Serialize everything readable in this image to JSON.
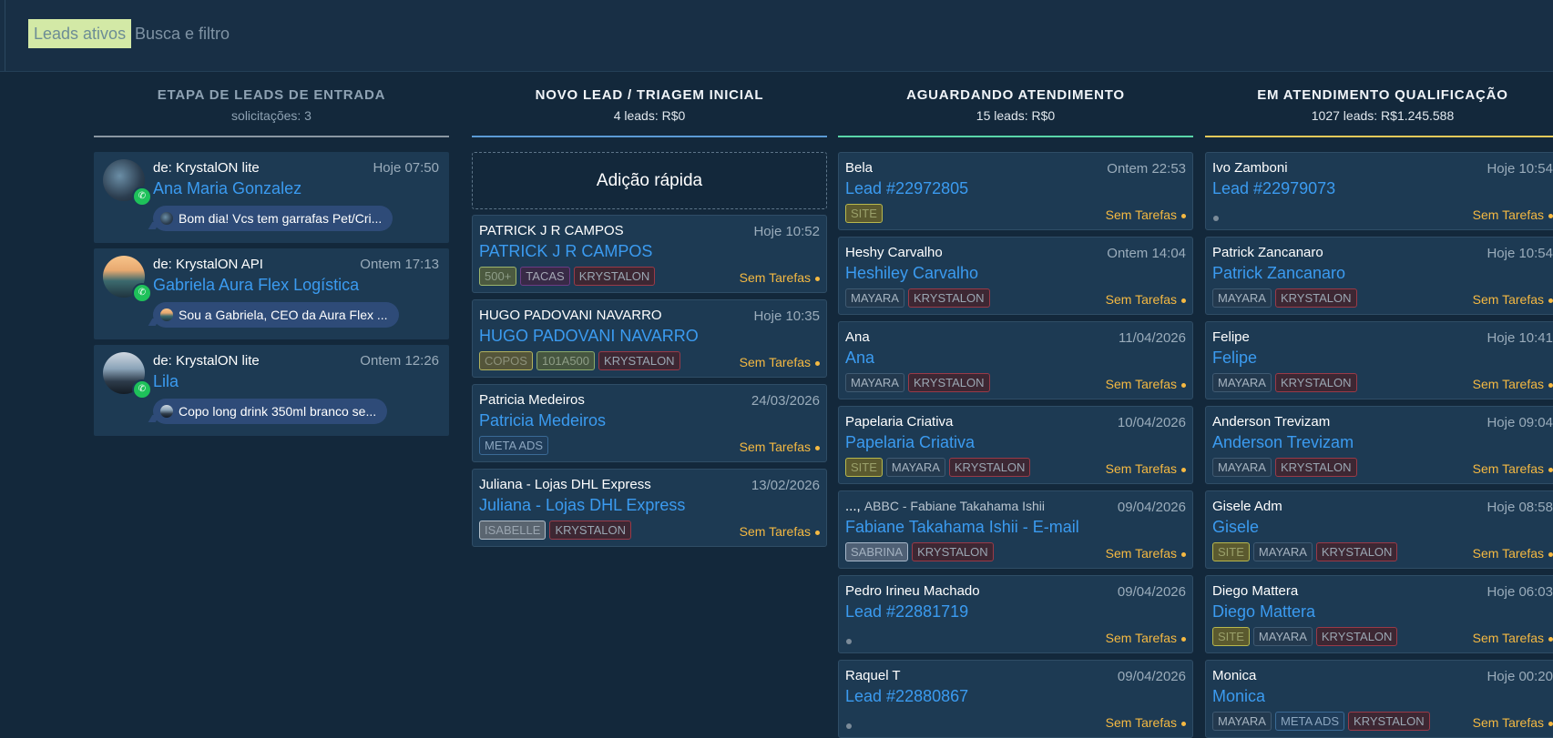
{
  "topbar": {
    "filter_pill": "Leads ativos",
    "search_placeholder": "Busca e filtro"
  },
  "columns": {
    "incoming": {
      "title": "ETAPA DE LEADS DE ENTRADA",
      "subtitle": "solicitações: 3",
      "line_color": "#8a97a2",
      "cards": [
        {
          "from": "de: KrystalON lite",
          "time": "Hoje 07:50",
          "name": "Ana Maria Gonzalez",
          "message": "Bom dia! Vcs tem garrafas Pet/Cri..."
        },
        {
          "from": "de: KrystalON API",
          "time": "Ontem 17:13",
          "name": "Gabriela Aura Flex Logística",
          "message": "Sou a Gabriela, CEO da Aura Flex ..."
        },
        {
          "from": "de: KrystalON lite",
          "time": "Ontem 12:26",
          "name": "Lila",
          "message": "Copo long drink 350ml branco se..."
        }
      ]
    },
    "novo": {
      "title": "NOVO LEAD / TRIAGEM INICIAL",
      "subtitle": "4 leads: R$0",
      "line_color": "#5b9bd5",
      "quick_add": "Adição rápida",
      "cards": [
        {
          "name": "PATRICK J R CAMPOS",
          "time": "Hoje 10:52",
          "lead": "PATRICK J R CAMPOS",
          "status": "Sem Tarefas",
          "tags": [
            {
              "label": "500+",
              "cls": "t-500"
            },
            {
              "label": "TACAS",
              "cls": "t-tacas"
            },
            {
              "label": "KRYSTALON",
              "cls": "t-krys"
            }
          ]
        },
        {
          "name": "HUGO PADOVANI NAVARRO",
          "time": "Hoje 10:35",
          "lead": "HUGO PADOVANI NAVARRO",
          "status": "Sem Tarefas",
          "tags": [
            {
              "label": "COPOS",
              "cls": "t-copos"
            },
            {
              "label": "101A500",
              "cls": "t-101"
            },
            {
              "label": "KRYSTALON",
              "cls": "t-krys"
            }
          ]
        },
        {
          "name": "Patricia Medeiros",
          "time": "24/03/2026",
          "lead": "Patricia Medeiros",
          "status": "Sem Tarefas",
          "tags": [
            {
              "label": "META ADS",
              "cls": "t-meta"
            }
          ]
        },
        {
          "name": "Juliana - Lojas DHL Express",
          "time": "13/02/2026",
          "lead": "Juliana - Lojas DHL Express",
          "status": "Sem Tarefas",
          "tags": [
            {
              "label": "ISABELLE",
              "cls": "t-isabelle"
            },
            {
              "label": "KRYSTALON",
              "cls": "t-krys"
            }
          ]
        }
      ]
    },
    "aguardando": {
      "title": "AGUARDANDO ATENDIMENTO",
      "subtitle": "15 leads: R$0",
      "line_color": "#5ad6a9",
      "cards": [
        {
          "name": "Bela",
          "time": "Ontem 22:53",
          "lead": "Lead #22972805",
          "status": "Sem Tarefas",
          "tags": [
            {
              "label": "SITE",
              "cls": "t-site"
            }
          ]
        },
        {
          "name": "Heshy Carvalho",
          "time": "Ontem 14:04",
          "lead": "Heshiley Carvalho",
          "status": "Sem Tarefas",
          "tags": [
            {
              "label": "MAYARA",
              "cls": "t-mayara"
            },
            {
              "label": "KRYSTALON",
              "cls": "t-krys"
            }
          ]
        },
        {
          "name": "Ana",
          "time": "11/04/2026",
          "lead": "Ana",
          "status": "Sem Tarefas",
          "tags": [
            {
              "label": "MAYARA",
              "cls": "t-mayara"
            },
            {
              "label": "KRYSTALON",
              "cls": "t-krys"
            }
          ]
        },
        {
          "name": "Papelaria Criativa",
          "time": "10/04/2026",
          "lead": "Papelaria Criativa",
          "status": "Sem Tarefas",
          "tags": [
            {
              "label": "SITE",
              "cls": "t-site"
            },
            {
              "label": "MAYARA",
              "cls": "t-mayara"
            },
            {
              "label": "KRYSTALON",
              "cls": "t-krys"
            }
          ]
        },
        {
          "prefix": "...,",
          "name": "ABBC - Fabiane Takahama Ishii",
          "time": "09/04/2026",
          "lead": "Fabiane Takahama Ishii - E-mail",
          "status": "Sem Tarefas",
          "tags": [
            {
              "label": "SABRINA",
              "cls": "t-sabrina"
            },
            {
              "label": "KRYSTALON",
              "cls": "t-krys"
            }
          ]
        },
        {
          "name": "Pedro Irineu Machado",
          "time": "09/04/2026",
          "lead": "Lead #22881719",
          "status": "Sem Tarefas",
          "tags": []
        },
        {
          "name": "Raquel T",
          "time": "09/04/2026",
          "lead": "Lead #22880867",
          "status": "Sem Tarefas",
          "tags": []
        }
      ]
    },
    "qualificacao": {
      "title": "EM ATENDIMENTO QUALIFICAÇÃO",
      "subtitle": "1027 leads: R$1.245.588",
      "line_color": "#e5c95a",
      "cards": [
        {
          "name": "Ivo Zamboni",
          "time": "Hoje 10:54",
          "lead": "Lead #22979073",
          "status": "Sem Tarefas",
          "tags": []
        },
        {
          "name": "Patrick Zancanaro",
          "time": "Hoje 10:54",
          "lead": "Patrick Zancanaro",
          "status": "Sem Tarefas",
          "tags": [
            {
              "label": "MAYARA",
              "cls": "t-mayara"
            },
            {
              "label": "KRYSTALON",
              "cls": "t-krys"
            }
          ]
        },
        {
          "name": "Felipe",
          "time": "Hoje 10:41",
          "lead": "Felipe",
          "status": "Sem Tarefas",
          "tags": [
            {
              "label": "MAYARA",
              "cls": "t-mayara"
            },
            {
              "label": "KRYSTALON",
              "cls": "t-krys"
            }
          ]
        },
        {
          "name": "Anderson Trevizam",
          "time": "Hoje 09:04",
          "lead": "Anderson Trevizam",
          "status": "Sem Tarefas",
          "tags": [
            {
              "label": "MAYARA",
              "cls": "t-mayara"
            },
            {
              "label": "KRYSTALON",
              "cls": "t-krys"
            }
          ]
        },
        {
          "name": "Gisele Adm",
          "time": "Hoje 08:58",
          "lead": "Gisele",
          "status": "Sem Tarefas",
          "tags": [
            {
              "label": "SITE",
              "cls": "t-site"
            },
            {
              "label": "MAYARA",
              "cls": "t-mayara"
            },
            {
              "label": "KRYSTALON",
              "cls": "t-krys"
            }
          ]
        },
        {
          "name": "Diego Mattera",
          "time": "Hoje 06:03",
          "lead": "Diego Mattera",
          "status": "Sem Tarefas",
          "tags": [
            {
              "label": "SITE",
              "cls": "t-site"
            },
            {
              "label": "MAYARA",
              "cls": "t-mayara"
            },
            {
              "label": "KRYSTALON",
              "cls": "t-krys"
            }
          ]
        },
        {
          "name": "Monica",
          "time": "Hoje 00:20",
          "lead": "Monica",
          "status": "Sem Tarefas",
          "tags": [
            {
              "label": "MAYARA",
              "cls": "t-mayara"
            },
            {
              "label": "META ADS",
              "cls": "t-metaads2"
            },
            {
              "label": "KRYSTALON",
              "cls": "t-krys"
            }
          ]
        }
      ]
    }
  }
}
